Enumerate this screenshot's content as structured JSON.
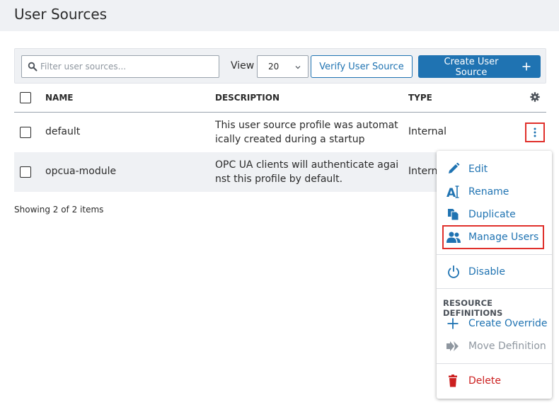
{
  "page": {
    "title": "User Sources"
  },
  "toolbar": {
    "filter_placeholder": "Filter user sources...",
    "view_label": "View",
    "view_value": "20",
    "verify_label": "Verify User Source",
    "create_label": "Create User Source"
  },
  "table": {
    "headers": {
      "name": "NAME",
      "description": "DESCRIPTION",
      "type": "TYPE"
    },
    "rows": [
      {
        "name": "default",
        "description": "This user source profile was automatically created during a startup",
        "type": "Internal"
      },
      {
        "name": "opcua-module",
        "description": "OPC UA clients will authenticate against this profile by default.",
        "type": "Internal"
      }
    ]
  },
  "footer": {
    "showing": "Showing 2 of 2 items"
  },
  "menu": {
    "edit": "Edit",
    "rename": "Rename",
    "duplicate": "Duplicate",
    "manage_users": "Manage Users",
    "disable": "Disable",
    "section_resource_definitions": "RESOURCE DEFINITIONS",
    "create_override": "Create Override",
    "move_definition": "Move Definition",
    "delete": "Delete"
  },
  "colors": {
    "accent": "#1f73b2",
    "danger": "#cc2020",
    "highlight": "#e0302b",
    "header_bg": "#eff1f4"
  },
  "icons": [
    "search-icon",
    "chevron-down-icon",
    "plus-icon",
    "gear-icon",
    "kebab-icon",
    "pencil-icon",
    "rename-icon",
    "duplicate-icon",
    "users-icon",
    "power-icon",
    "plus-icon",
    "double-arrow-icon",
    "trash-icon"
  ]
}
